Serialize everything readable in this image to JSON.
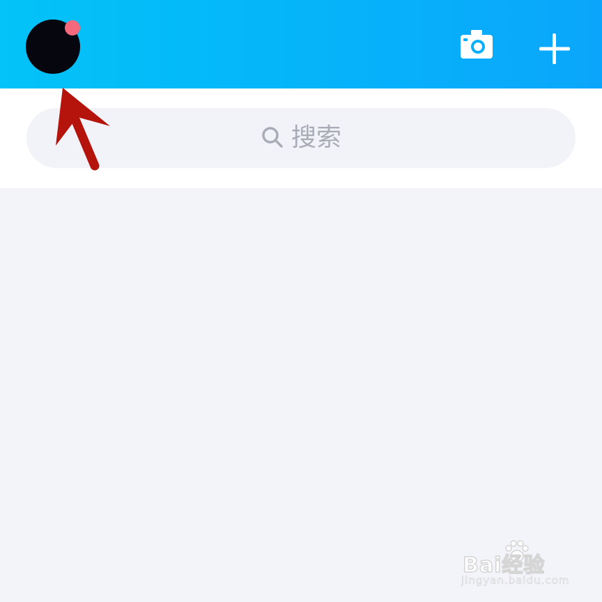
{
  "header": {
    "background_colors": [
      "#03c3f8",
      "#0ba6fb"
    ],
    "avatar_badge_color": "#f4697c",
    "camera_icon": "camera-icon",
    "add_icon": "plus-icon"
  },
  "search": {
    "placeholder": "搜索",
    "icon": "search-icon"
  },
  "annotation": {
    "arrow_color": "#b5140c",
    "points_to": "avatar"
  },
  "watermark": {
    "brand": "Bai经验",
    "url": "jingyan.baidu.com"
  }
}
